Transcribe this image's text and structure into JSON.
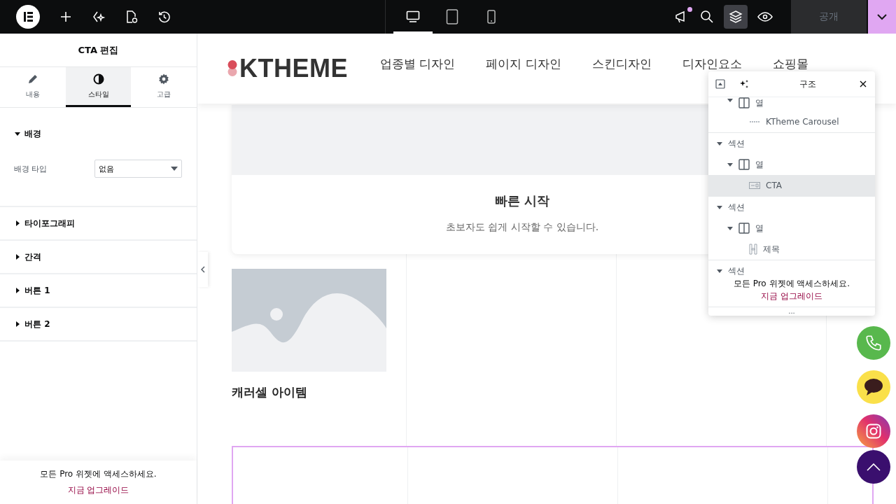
{
  "topbar": {
    "device_tabs": [
      {
        "kind": "desktop",
        "selected": true
      },
      {
        "kind": "tablet",
        "selected": false
      },
      {
        "kind": "mobile",
        "selected": false
      }
    ],
    "notification": true,
    "structure_active": true,
    "publish_label": "공개",
    "publish_disabled": true
  },
  "panel": {
    "title": "CTA 편집",
    "tabs": [
      {
        "label": "내용",
        "kind": "pencil",
        "selected": false
      },
      {
        "label": "스타일",
        "kind": "contrast",
        "selected": true
      },
      {
        "label": "고급",
        "kind": "gear",
        "selected": false
      }
    ],
    "sections": [
      {
        "title": "배경",
        "expanded": true,
        "fields": [
          {
            "label": "배경 타입",
            "value": "없음"
          }
        ]
      },
      {
        "title": "타이포그래피",
        "expanded": false
      },
      {
        "title": "간격",
        "expanded": false
      },
      {
        "title": "버튼 1",
        "expanded": false
      },
      {
        "title": "버튼 2",
        "expanded": false
      }
    ],
    "promo": {
      "text": "모든 Pro 위젯에 액세스하세요.",
      "link": "지금 업그레이드"
    }
  },
  "site": {
    "logo": "KTHEME",
    "menu": [
      "업종별 디자인",
      "페이지 디자인",
      "스킨디자인",
      "디자인요소",
      "쇼핑몰"
    ],
    "cta": {
      "title": "빠른 시작",
      "text": "초보자도 쉽게 시작할 수 있습니다."
    },
    "carousel_item": {
      "title": "캐러셀 아이템"
    }
  },
  "navigator": {
    "title": "구조",
    "items": [
      {
        "label": "열",
        "kind": "column",
        "expanded": true,
        "selected": false,
        "children": [
          {
            "label": "KTheme Carousel",
            "kind": "carousel",
            "selected": false
          }
        ]
      },
      {
        "label": "섹션",
        "kind": "section",
        "expanded": true,
        "selected": false,
        "children": [
          {
            "label": "열",
            "kind": "column",
            "expanded": true,
            "selected": false,
            "children": [
              {
                "label": "CTA",
                "kind": "cta",
                "selected": true
              }
            ]
          }
        ]
      },
      {
        "label": "섹션",
        "kind": "section",
        "expanded": true,
        "selected": false,
        "children": [
          {
            "label": "열",
            "kind": "column",
            "expanded": true,
            "selected": false,
            "children": [
              {
                "label": "제목",
                "kind": "heading",
                "selected": false
              }
            ]
          }
        ]
      },
      {
        "label": "섹션",
        "kind": "section",
        "expanded": true,
        "selected": false
      }
    ],
    "promo": {
      "text": "모든 Pro 위젯에 액세스하세요.",
      "link": "지금 업그레이드"
    },
    "more": "..."
  }
}
